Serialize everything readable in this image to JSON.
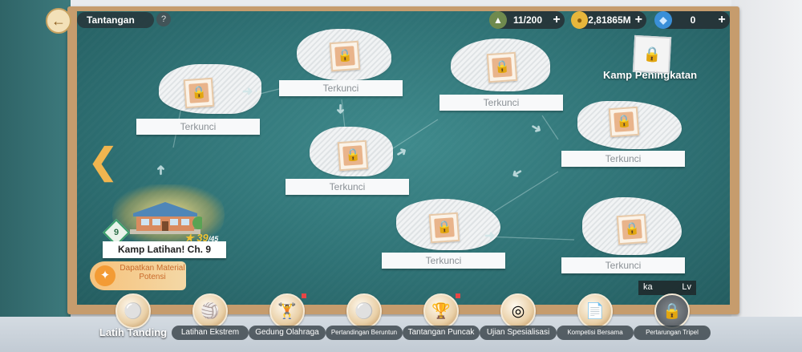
{
  "header": {
    "title": "Tantangan",
    "help": "?",
    "back_icon": "arrow-left-icon"
  },
  "resources": [
    {
      "name": "stamina",
      "icon": "cap-icon",
      "value": "11/200",
      "plus": "+"
    },
    {
      "name": "coins",
      "icon": "coin-icon",
      "value": "2,81865M",
      "plus": "+"
    },
    {
      "name": "diamonds",
      "icon": "diamond-icon",
      "value": "0",
      "plus": "+"
    }
  ],
  "map": {
    "locked_label": "Terkunci",
    "current": {
      "level": "9",
      "stars": "39",
      "stars_max": "/45",
      "name": "Kamp Latihan! Ch. 9"
    },
    "material_button": "Dapatkan Material Potensi",
    "upgrade_camp": "Kamp Peningkatan",
    "rank": {
      "left": "ka",
      "right": "Lv"
    }
  },
  "tabs": [
    {
      "label": "Latih Tanding",
      "icon": "whistle-icon"
    },
    {
      "label": "Latihan Ekstrem",
      "icon": "volleyball-icon"
    },
    {
      "label": "Gedung Olahraga",
      "icon": "dumbbell-icon"
    },
    {
      "label": "Pertandingan Beruntun",
      "icon": "ball-icon"
    },
    {
      "label": "Tantangan Puncak",
      "icon": "trophy-icon"
    },
    {
      "label": "Ujian Spesialisasi",
      "icon": "badge-icon"
    },
    {
      "label": "Kompetisi Bersama",
      "icon": "paper-icon"
    },
    {
      "label": "Pertarungan Tripel",
      "icon": "lock-icon"
    }
  ],
  "colors": {
    "board": "#2f7275",
    "frame": "#c69c6d",
    "accent": "#f1b54f"
  }
}
